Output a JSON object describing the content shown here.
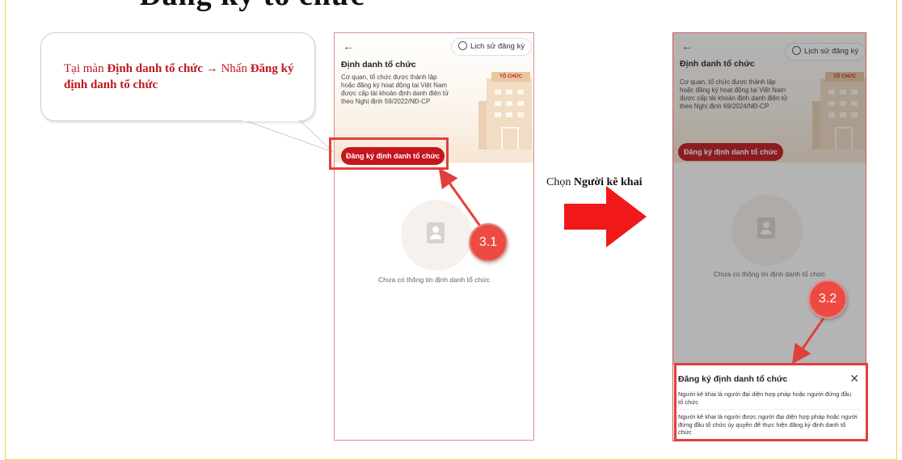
{
  "page_heading": "Đăng ký tổ chức",
  "callout": {
    "prefix": "Tại màn ",
    "screen_name": "Định danh tổ chức",
    "arrow": " → ",
    "action_word": "Nhấn ",
    "button_name": "Đăng ký định danh tổ chức"
  },
  "phone_a": {
    "back_icon": "back-arrow-icon",
    "history_button": "Lịch sử đăng ký",
    "title": "Định danh tổ chức",
    "description": "Cơ quan, tổ chức được thành lập hoặc đăng ký hoạt động tại Việt Nam được cấp tài khoản định danh điện tử theo Nghị định 59/2022/NĐ-CP",
    "building_sign": "TỔ CHỨC",
    "register_button": "Đăng ký định danh tổ chức",
    "empty_text": "Chưa có thông tin định danh tổ chức",
    "step_badge": "3.1"
  },
  "middle": {
    "label_prefix": "Chọn ",
    "label_bold": "Người kê khai"
  },
  "phone_b": {
    "back_icon": "back-arrow-icon",
    "history_button": "Lịch sử đăng ký",
    "title": "Định danh tổ chức",
    "description": "Cơ quan, tổ chức được thành lập hoặc đăng ký hoạt động tại Việt Nam được cấp tài khoản định danh điện tử theo Nghị định 69/2024/NĐ-CP",
    "building_sign": "TỔ CHỨC",
    "register_button": "Đăng ký định danh tổ chức",
    "empty_text": "Chưa có thông tin định danh tổ chức",
    "step_badge": "3.2",
    "sheet": {
      "title": "Đăng ký định danh tổ chức",
      "close_icon": "close-icon",
      "option_1": "Người kê khai là người đại diện hợp pháp hoặc người đứng đầu tổ chức",
      "option_2": "Người kê khai là người được người đại diện hợp pháp hoặc người đứng đầu tổ chức ủy quyền để thực hiện đăng ký định danh tổ chức"
    }
  },
  "colors": {
    "brand_red": "#c4161c",
    "highlight": "#e0403c",
    "arrow_red": "#f01818",
    "badge": "#ec4a43",
    "callout_text": "#c0171e"
  }
}
